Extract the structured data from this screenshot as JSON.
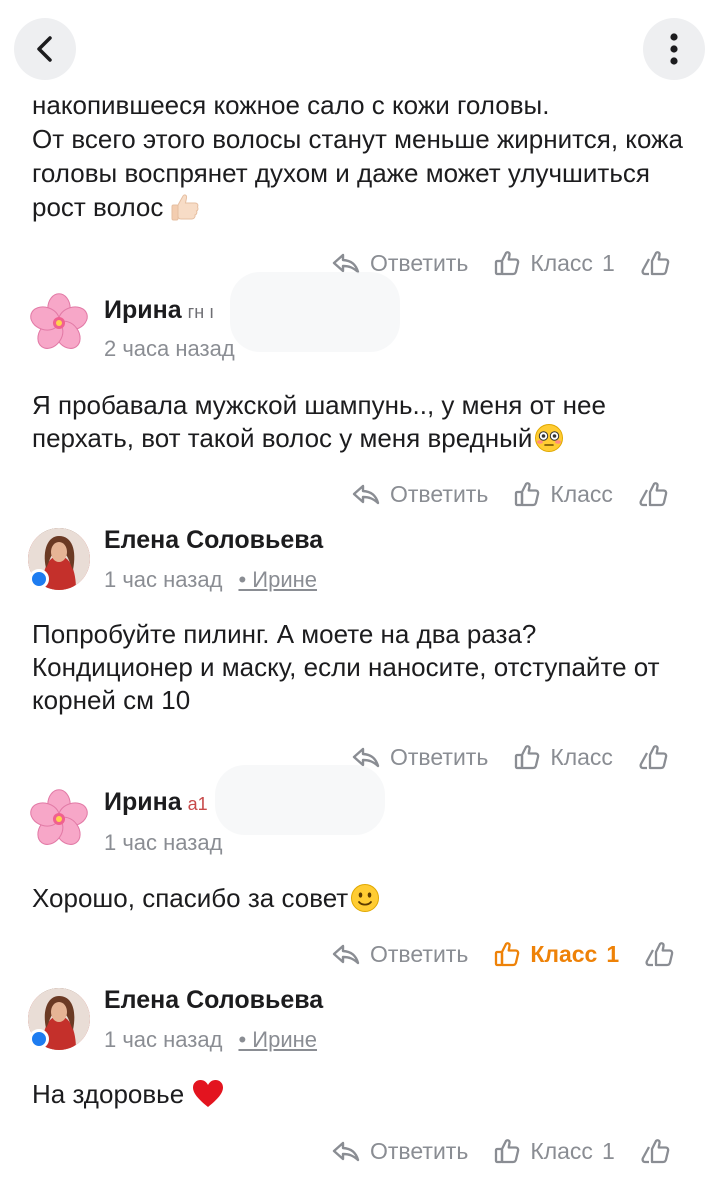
{
  "toolbar": {
    "back_icon": "chevron-left-icon",
    "more_icon": "more-vertical-icon"
  },
  "continuation": {
    "text": "накопившееся кожное сало с кожи головы.\nОт всего этого волосы станут меньше жирнится, кожа головы воспрянет духом и даже может улучшиться рост волос",
    "emoji": "thumbs-up"
  },
  "action_labels": {
    "reply": "Ответить",
    "like": "Класс"
  },
  "comments": [
    {
      "author": "Ирина",
      "author_suffix": "гн ı",
      "time": "2 часа назад",
      "reply_to": "",
      "text": "Я пробавала мужской шампунь.., у меня от нее перхать, вот такой волос у меня вредный",
      "emoji": "flushed-face",
      "likes": ""
    },
    {
      "author": "Елена Соловьева",
      "author_suffix": "",
      "time": "1 час назад",
      "reply_to": "• Ирине",
      "text": "Попробуйте пилинг. А моете на два раза? Кондиционер и маску, если наносите, отступайте от корней см 10",
      "emoji": "",
      "likes": ""
    },
    {
      "author": "Ирина",
      "author_suffix": "а1",
      "time": "1 час назад",
      "reply_to": "",
      "text": "Хорошо, спасибо за совет",
      "emoji": "slightly-smiling-face",
      "likes": "1"
    },
    {
      "author": "Елена Соловьева",
      "author_suffix": "",
      "time": "1 час назад",
      "reply_to": "• Ирине",
      "text": "На здоровье",
      "emoji": "red-heart",
      "likes": ""
    }
  ],
  "continuation_likes": "1",
  "last_likes": "1",
  "colors": {
    "accent_liked": "#ee8208",
    "muted_text": "#8a8d93",
    "presence_dot": "#1e7cf0"
  }
}
